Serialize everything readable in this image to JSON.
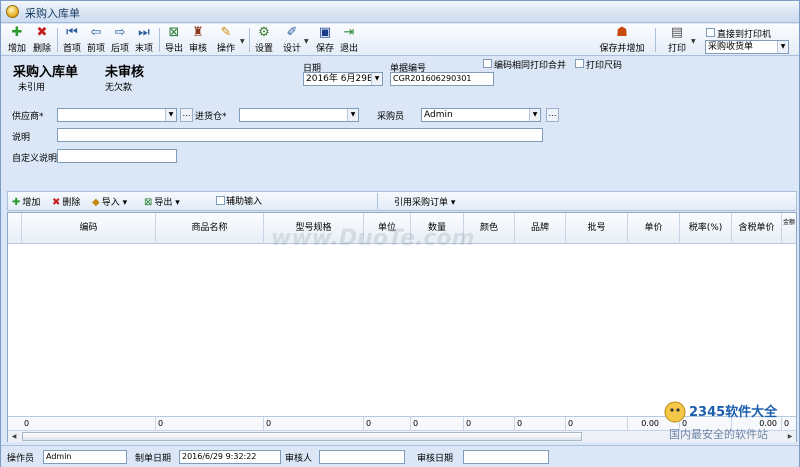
{
  "window": {
    "title": "采购入库单"
  },
  "toolbar": {
    "add": "增加",
    "delete": "删除",
    "first": "首项",
    "prev": "前项",
    "next": "后项",
    "last": "末项",
    "export": "导出",
    "audit": "审核",
    "action": "操作",
    "settings": "设置",
    "design": "设计",
    "save": "保存",
    "exit": "退出",
    "save_add": "保存并增加",
    "print": "打印",
    "direct_print": "直接到打印机",
    "print_template": "采购收货单"
  },
  "header": {
    "doc_title": "采购入库单",
    "status": "未审核",
    "reference": "未引用",
    "payment": "无欠款",
    "date_label": "日期",
    "date_value": "2016年 6月29E",
    "docno_label": "单据编号",
    "docno_value": "CGR201606290301",
    "merge_print_label": "编码相同打印合并",
    "print_ruler_label": "打印尺码"
  },
  "fields": {
    "supplier_label": "供应商*",
    "supplier_value": "",
    "warehouse_label": "进货仓*",
    "warehouse_value": "",
    "buyer_label": "采购员",
    "buyer_value": "Admin",
    "note_label": "说明",
    "note_value": "",
    "custom_note_label": "自定义说明",
    "custom_note_value": ""
  },
  "grid_toolbar": {
    "add": "增加",
    "delete": "删除",
    "import": "导入",
    "export": "导出",
    "assist_input": "辅助输入",
    "ref_order": "引用采购订单"
  },
  "grid": {
    "columns": [
      "编码",
      "商品名称",
      "型号规格",
      "单位",
      "数量",
      "颜色",
      "品牌",
      "批号",
      "单价",
      "税率(%)",
      "含税单价",
      "金额"
    ],
    "footer": [
      "0",
      "0",
      "0",
      "0",
      "0",
      "0",
      "0",
      "0",
      "0.00",
      "0",
      "0.00",
      "0"
    ]
  },
  "statusbar": {
    "operator_label": "操作员",
    "operator_value": "Admin",
    "created_label": "制单日期",
    "created_value": "2016/6/29 9:32:22",
    "auditor_label": "审核人",
    "auditor_value": "",
    "audit_date_label": "审核日期",
    "audit_date_value": ""
  },
  "watermark": {
    "text": "www.DuoTe.com"
  },
  "brand": {
    "logo_text": "2345软件大全",
    "slogan": "国内最安全的软件站"
  },
  "colors": {
    "accent": "#1c5fae",
    "frame": "#dbe7f6",
    "border": "#7f9db9"
  }
}
